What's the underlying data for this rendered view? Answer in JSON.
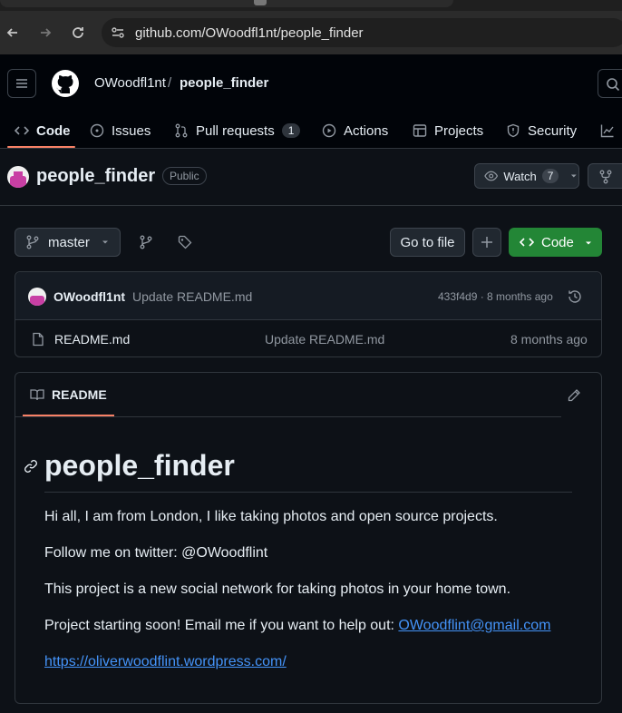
{
  "browser": {
    "url": "github.com/OWoodfl1nt/people_finder"
  },
  "header": {
    "owner": "OWoodfl1nt",
    "separator": "/",
    "repo": "people_finder"
  },
  "repo_nav": {
    "items": [
      {
        "label": "Code",
        "icon": "code-icon",
        "active": true
      },
      {
        "label": "Issues",
        "icon": "issue-icon"
      },
      {
        "label": "Pull requests",
        "icon": "pull-request-icon",
        "count": "1"
      },
      {
        "label": "Actions",
        "icon": "play-icon"
      },
      {
        "label": "Projects",
        "icon": "table-icon"
      },
      {
        "label": "Security",
        "icon": "shield-icon"
      }
    ]
  },
  "repo": {
    "name": "people_finder",
    "visibility": "Public",
    "watch_label": "Watch",
    "watch_count": "7"
  },
  "toolbar": {
    "branch": "master",
    "goto_file": "Go to file",
    "code_label": "Code"
  },
  "latest_commit": {
    "author": "OWoodfl1nt",
    "message": "Update README.md",
    "meta": "433f4d9 · 8 months ago"
  },
  "files": [
    {
      "name": "README.md",
      "commit": "Update README.md",
      "date": "8 months ago"
    }
  ],
  "readme": {
    "tab_label": "README",
    "heading": "people_finder",
    "p1": "Hi all, I am from London, I like taking photos and open source projects.",
    "p2": "Follow me on twitter: @OWoodflint",
    "p3": "This project is a new social network for taking photos in your home town.",
    "p4_text": "Project starting soon! Email me if you want to help out: ",
    "p4_link": "OWoodflint@gmail.com",
    "p5_link": "https://oliverwoodflint.wordpress.com/"
  },
  "colors": {
    "bg": "#0d1117",
    "header_bg": "#010409",
    "accent_underline": "#f78166",
    "primary_button": "#238636",
    "link": "#4493f8"
  }
}
